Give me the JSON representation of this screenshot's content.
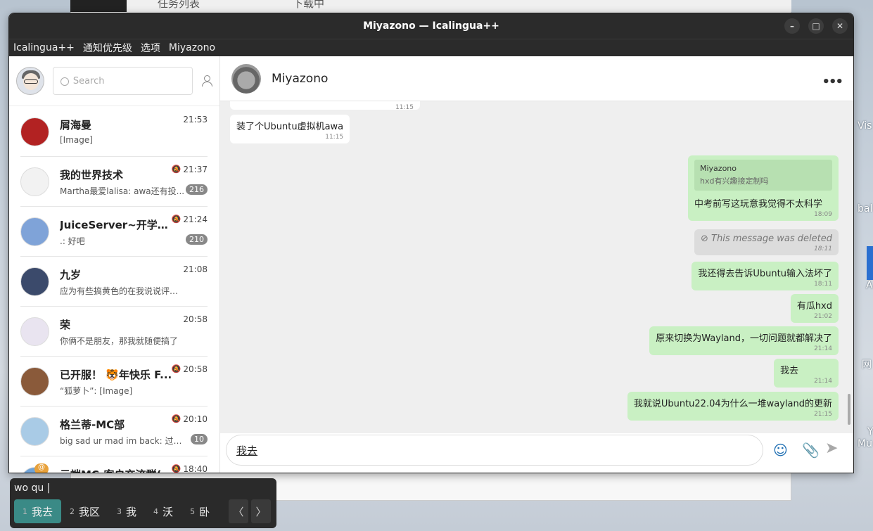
{
  "background": {
    "tab_text_1": "任务列表",
    "tab_text_2": "下载中",
    "right_labels": [
      "Vis",
      "bal",
      "A",
      "网",
      "Y",
      "Mu"
    ]
  },
  "window": {
    "title": "Miyazono — Icalingua++",
    "buttons": [
      "–",
      "□",
      "✕"
    ]
  },
  "menu": [
    "Icalingua++",
    "通知优先级",
    "选项",
    "Miyazono"
  ],
  "sidebar": {
    "search_placeholder": "Search",
    "conversations": [
      {
        "name": "屑海曼",
        "preview": "[Image]",
        "time": "21:53",
        "muted": false,
        "unread": "",
        "color": "#b22222"
      },
      {
        "name": "我的世界技术",
        "preview": "Martha最爱lalisa: awa还有投...",
        "time": "21:37",
        "muted": true,
        "unread": "216",
        "color": "#f2f2f2"
      },
      {
        "name": "JuiceServer~开学快...",
        "preview": ".: 好吧",
        "time": "21:24",
        "muted": true,
        "unread": "210",
        "color": "#7fa3d8"
      },
      {
        "name": "九岁",
        "preview": "应为有些搞黄色的在我说说评论一些...",
        "time": "21:08",
        "muted": false,
        "unread": "",
        "color": "#3b4a6b"
      },
      {
        "name": "荣",
        "preview": "你俩不是朋友，那我就随便搞了",
        "time": "20:58",
        "muted": false,
        "unread": "",
        "color": "#e9e4f0"
      },
      {
        "name": "已开服！ 🐯年快乐 F...",
        "preview": "“狐萝卜”: [Image]",
        "time": "20:58",
        "muted": true,
        "unread": "",
        "color": "#8a5a3a"
      },
      {
        "name": "格兰蒂-MC部",
        "preview": "big sad ur mad im back: 过一会...",
        "time": "20:10",
        "muted": true,
        "unread": "10",
        "color": "#a9cbe6"
      },
      {
        "name": "云端MC-客户交流群(",
        "preview": "",
        "time": "18:40",
        "muted": true,
        "unread": "",
        "color": "#6fa3d8"
      }
    ],
    "at_badge": "@"
  },
  "chat": {
    "title": "Miyazono",
    "more": "•••",
    "messages": [
      {
        "dir": "in",
        "text": "",
        "time": "11:15"
      },
      {
        "dir": "in",
        "text": "装了个Ubuntu虚拟机awa",
        "time": "11:15"
      },
      {
        "dir": "out",
        "quote_name": "Miyazono",
        "quote_text": "hxd有兴趣接定制吗",
        "text": "中考前写这玩意我觉得不太科学",
        "time": "18:09"
      },
      {
        "dir": "deleted",
        "text": "This message was deleted",
        "time": "18:11"
      },
      {
        "dir": "out",
        "text": "我还得去告诉Ubuntu输入法坏了",
        "time": "18:11"
      },
      {
        "dir": "out",
        "text": "有瓜hxd",
        "time": "21:02"
      },
      {
        "dir": "out",
        "text": "原来切换为Wayland，一切问题就都解决了",
        "time": "21:14"
      },
      {
        "dir": "out",
        "text": "我去",
        "time": "21:14"
      },
      {
        "dir": "out",
        "text": "我就说Ubuntu22.04为什么一堆wayland的更新",
        "time": "21:15"
      }
    ],
    "composer_text": "我去"
  },
  "ime": {
    "preedit": "wo qu |",
    "candidates": [
      {
        "num": "1",
        "text": "我去"
      },
      {
        "num": "2",
        "text": "我区"
      },
      {
        "num": "3",
        "text": "我"
      },
      {
        "num": "4",
        "text": "沃"
      },
      {
        "num": "5",
        "text": "卧"
      }
    ],
    "prev": "〈",
    "next": "〉"
  }
}
